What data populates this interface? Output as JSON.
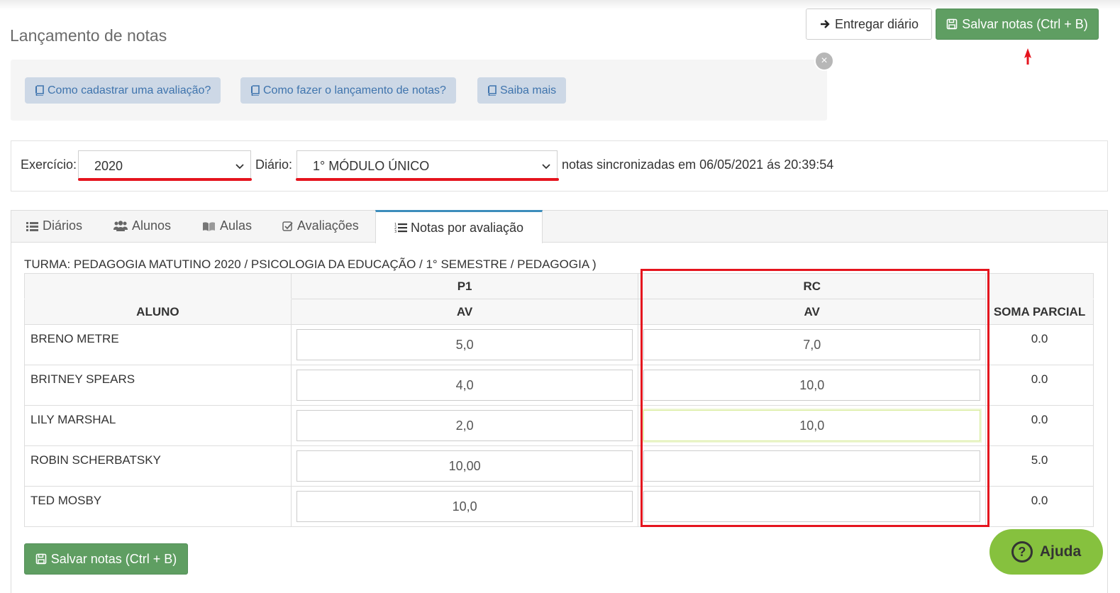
{
  "page": {
    "title": "Lançamento de notas"
  },
  "header": {
    "deliver_label": "Entregar diário",
    "save_label": "Salvar notas (Ctrl + B)"
  },
  "help_links": [
    {
      "label": "Como cadastrar uma avaliação?"
    },
    {
      "label": "Como fazer o lançamento de notas?"
    },
    {
      "label": "Saiba mais"
    }
  ],
  "help_close": "×",
  "filters": {
    "exercicio_label": "Exercício:",
    "exercicio_value": "2020",
    "diario_label": "Diário:",
    "diario_value": "1° MÓDULO ÚNICO",
    "sync_text": "notas sincronizadas em 06/05/2021 ás 20:39:54"
  },
  "tabs": [
    {
      "label": "Diários",
      "icon": "list-icon"
    },
    {
      "label": "Alunos",
      "icon": "users-icon"
    },
    {
      "label": "Aulas",
      "icon": "book-open-icon"
    },
    {
      "label": "Avaliações",
      "icon": "check-square-icon"
    },
    {
      "label": "Notas por avaliação",
      "icon": "list-ol-icon",
      "active": true
    }
  ],
  "turma": "TURMA: PEDAGOGIA MATUTINO 2020 / PSICOLOGIA DA EDUCAÇÃO / 1° SEMESTRE / PEDAGOGIA )",
  "table": {
    "group_p1": "P1",
    "group_rc": "RC",
    "col_aluno": "ALUNO",
    "col_av_p1": "AV",
    "col_av_rc": "AV",
    "col_soma": "SOMA PARCIAL",
    "rows": [
      {
        "name": "BRENO METRE",
        "p1": "5,0",
        "rc": "7,0",
        "soma": "0.0"
      },
      {
        "name": "BRITNEY SPEARS",
        "p1": "4,0",
        "rc": "10,0",
        "soma": "0.0"
      },
      {
        "name": "LILY MARSHAL",
        "p1": "2,0",
        "rc": "10,0",
        "soma": "0.0"
      },
      {
        "name": "ROBIN SCHERBATSKY",
        "p1": "10,00",
        "rc": "",
        "soma": "5.0"
      },
      {
        "name": "TED MOSBY",
        "p1": "10,0",
        "rc": "",
        "soma": "0.0"
      }
    ]
  },
  "footer": {
    "save_label": "Salvar notas (Ctrl + B)"
  },
  "help_float": {
    "label": "Ajuda",
    "icon_glyph": "?"
  },
  "colors": {
    "save_green": "#5f9e62",
    "annotation_red": "#e5141e",
    "link_blue": "#3f74ad",
    "help_green": "#86c13e"
  }
}
